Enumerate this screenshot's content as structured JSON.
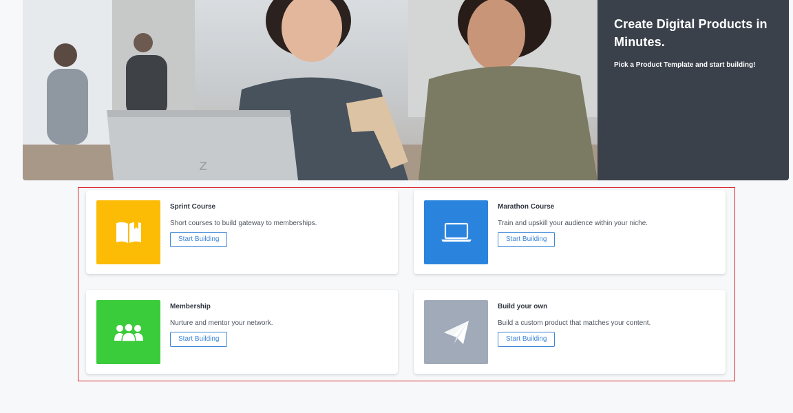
{
  "hero": {
    "title": "Create Digital Products in Minutes.",
    "subtitle": "Pick a Product Template and start building!",
    "panel_color": "#3b414b"
  },
  "templates": [
    {
      "title": "Sprint Course",
      "description": "Short courses to build gateway to memberships.",
      "button_label": "Start Building",
      "icon": "book-icon",
      "color": "#fcbb05"
    },
    {
      "title": "Marathon Course",
      "description": "Train and upskill your audience within your niche.",
      "button_label": "Start Building",
      "icon": "laptop-icon",
      "color": "#2a84de"
    },
    {
      "title": "Membership",
      "description": "Nurture and mentor your network.",
      "button_label": "Start Building",
      "icon": "group-icon",
      "color": "#3acc3a"
    },
    {
      "title": "Build your own",
      "description": "Build a custom product that matches your content.",
      "button_label": "Start Building",
      "icon": "paper-plane-icon",
      "color": "#a1aab8"
    }
  ],
  "colors": {
    "background": "#f6f8fa",
    "button_accent": "#3d86d8",
    "highlight_frame": "#d9262b"
  }
}
